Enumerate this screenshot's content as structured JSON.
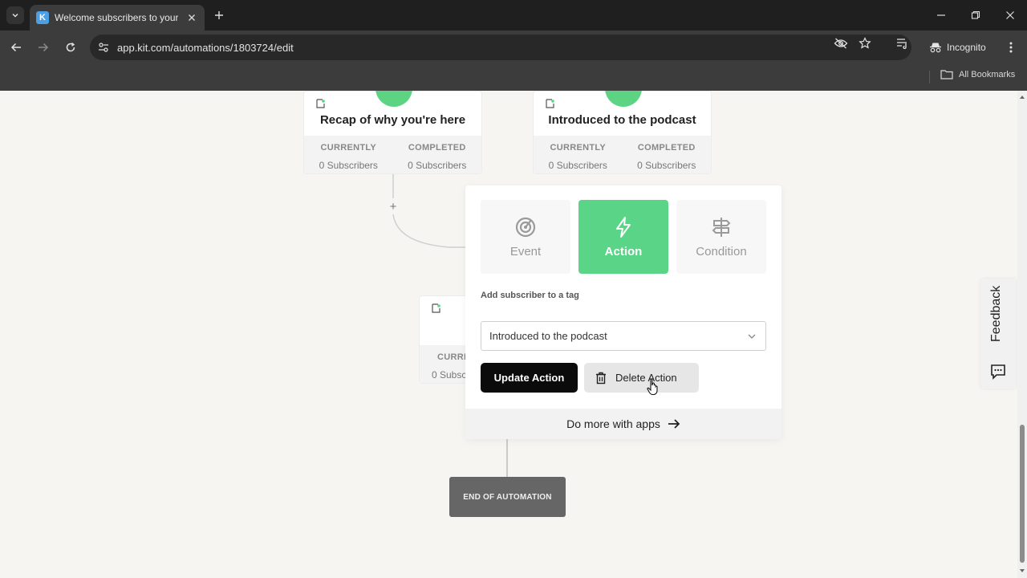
{
  "browser": {
    "tab_title": "Welcome subscribers to your podcast",
    "favicon_letter": "K",
    "url": "app.kit.com/automations/1803724/edit",
    "incognito_label": "Incognito",
    "all_bookmarks": "All Bookmarks"
  },
  "nodes": [
    {
      "title": "Recap of why you're here",
      "currently_label": "CURRENTLY",
      "completed_label": "COMPLETED",
      "currently_value": "0 Subscribers",
      "completed_value": "0 Subscribers"
    },
    {
      "title": "Introduced to the podcast",
      "currently_label": "CURRENTLY",
      "completed_label": "COMPLETED",
      "currently_value": "0 Subscribers",
      "completed_value": "0 Subscribers"
    },
    {
      "currently_label": "CURRE",
      "currently_value": "0 Subsc"
    }
  ],
  "add_step": "+",
  "end_label": "END OF AUTOMATION",
  "popover": {
    "types": [
      {
        "label": "Event",
        "icon": "radar-icon"
      },
      {
        "label": "Action",
        "icon": "lightning-icon",
        "active": true
      },
      {
        "label": "Condition",
        "icon": "signpost-icon"
      }
    ],
    "section_label": "Add subscriber to a tag",
    "selected_tag": "Introduced to the podcast",
    "update_label": "Update Action",
    "delete_label": "Delete Action",
    "footer": "Do more with apps"
  },
  "feedback_label": "Feedback",
  "colors": {
    "accent_green": "#5ad486",
    "chrome_dark": "#1f1f1f",
    "chrome_mid": "#3c3c3c"
  }
}
